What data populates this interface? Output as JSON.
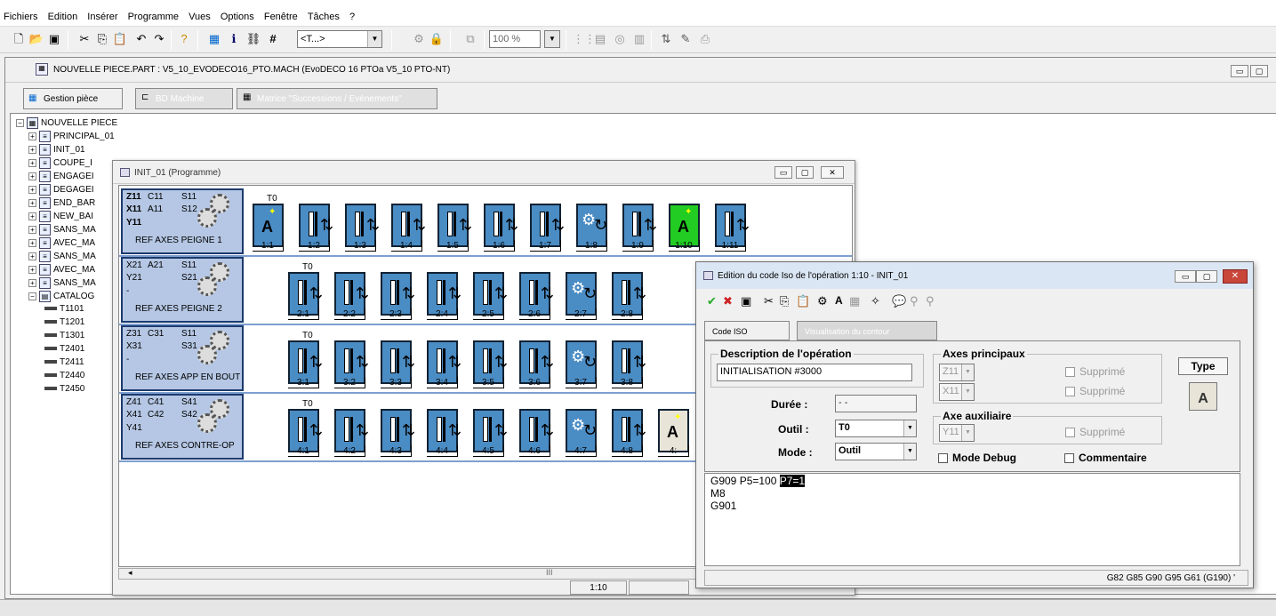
{
  "menu": [
    "Fichiers",
    "Edition",
    "Insérer",
    "Programme",
    "Vues",
    "Options",
    "Fenêtre",
    "Tâches",
    "?"
  ],
  "toolbar": {
    "combo_tool": "<T...>",
    "zoom": "100 %",
    "icons": [
      "new-icon",
      "open-icon",
      "save-icon",
      "cut-icon",
      "copy-icon",
      "paste-icon",
      "undo-icon",
      "redo-icon",
      "help-icon",
      "machine-icon",
      "info-icon",
      "link-icon",
      "hash-icon"
    ]
  },
  "mdi": {
    "title": "NOUVELLE PIECE.PART : V5_10_EVODECO16_PTO.MACH (EvoDECO 16 PTOa V5_10 PTO-NT)",
    "tabs": [
      "Gestion pièce",
      "BD Machine",
      "Matrice \"Successions / Evénements\""
    ]
  },
  "tree": {
    "root": "NOUVELLE PIECE",
    "items": [
      "PRINCIPAL_01",
      "INIT_01",
      "COUPE_I",
      "ENGAGEI",
      "DEGAGEI",
      "END_BAR",
      "NEW_BAI",
      "SANS_MA",
      "AVEC_MA",
      "SANS_MA",
      "AVEC_MA",
      "SANS_MA",
      "CATALOG"
    ],
    "tools": [
      "T1101",
      "T1201",
      "T1301",
      "T2401",
      "T2411",
      "T2440",
      "T2450"
    ]
  },
  "program": {
    "title": "INIT_01 (Programme)",
    "rows": [
      {
        "a": "Z11",
        "a2": "C11",
        "b": "X11",
        "b2": "A11",
        "c": "Y11",
        "s1": "S11",
        "s2": "S12",
        "name": "REF AXES PEIGNE 1",
        "t0": "T0",
        "ops": [
          "1:1",
          "1:2",
          "1:3",
          "1:4",
          "1:5",
          "1:6",
          "1:7",
          "1:8",
          "1:9",
          "1:10",
          "1:11"
        ]
      },
      {
        "a": "X21",
        "a2": "A21",
        "b": "Y21",
        "b2": "",
        "c": "-",
        "s1": "S11",
        "s2": "S21",
        "name": "REF AXES PEIGNE 2",
        "t0": "T0",
        "ops": [
          "2:1",
          "2:2",
          "2:3",
          "2:4",
          "2:5",
          "2:6",
          "2:7",
          "2:8"
        ]
      },
      {
        "a": "Z31",
        "a2": "C31",
        "b": "X31",
        "b2": "",
        "c": "-",
        "s1": "S11",
        "s2": "S31",
        "name": "REF AXES APP EN BOUT",
        "t0": "T0",
        "ops": [
          "3:1",
          "3:2",
          "3:3",
          "3:4",
          "3:5",
          "3:6",
          "3:7",
          "3:8"
        ]
      },
      {
        "a": "Z41",
        "a2": "C41",
        "b": "X41",
        "b2": "C42",
        "c": "Y41",
        "s1": "S41",
        "s2": "S42",
        "name": "REF AXES CONTRE-OP",
        "t0": "T0",
        "ops": [
          "4:1",
          "4:2",
          "4:3",
          "4:4",
          "4:5",
          "4:6",
          "4:7",
          "4:8",
          "4:"
        ]
      }
    ],
    "status": "1:10",
    "scroll_mark": "III"
  },
  "edit": {
    "title": "Edition du code Iso de l'opération 1:10 - INIT_01",
    "tabs": [
      "Code ISO",
      "Visualisation du contour"
    ],
    "desc_label": "Description de l'opération",
    "desc_value": "INITIALISATION #3000",
    "duree_label": "Durée :",
    "duree_value": "- -",
    "outil_label": "Outil :",
    "outil_value": "T0",
    "mode_label": "Mode :",
    "mode_value": "Outil",
    "axes_principaux": "Axes principaux",
    "axe1": "Z11",
    "axe2": "X11",
    "supprime": "Supprimé",
    "axe_auxiliaire": "Axe auxiliaire",
    "axe3": "Y11",
    "mode_debug": "Mode Debug",
    "commentaire": "Commentaire",
    "type_label": "Type",
    "code_line1": "G909 P5=100 ",
    "code_line1_hl": "P7=1",
    "code_line2": "M8",
    "code_line3": "G901",
    "status": "G82 G85 G90 G95 G61 (G190) '"
  }
}
